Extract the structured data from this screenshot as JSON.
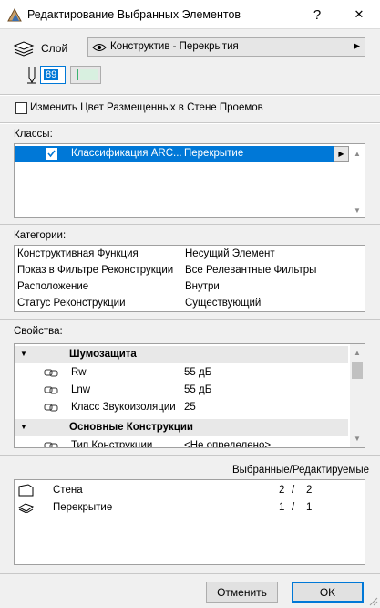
{
  "window": {
    "title": "Редактирование Выбранных Элементов",
    "help_glyph": "?",
    "close_glyph": "✕"
  },
  "layer": {
    "label": "Слой",
    "value": "Конструктив - Перекрытия"
  },
  "pen": {
    "value": "89"
  },
  "change_color_checkbox": {
    "label": "Изменить Цвет Размещенных в Стене Проемов",
    "checked": false
  },
  "classes": {
    "heading": "Классы:",
    "rows": [
      {
        "system": "Классификация ARC...",
        "value": "Перекрытие",
        "checked": true
      }
    ]
  },
  "categories": {
    "heading": "Категории:",
    "rows": [
      {
        "name": "Конструктивная Функция",
        "value": "Несущий Элемент"
      },
      {
        "name": "Показ в Фильтре Реконструкции",
        "value": "Все Релевантные Фильтры"
      },
      {
        "name": "Расположение",
        "value": "Внутри"
      },
      {
        "name": "Статус Реконструкции",
        "value": "Существующий"
      }
    ]
  },
  "properties": {
    "heading": "Свойства:",
    "group1": {
      "name": "Шумозащита"
    },
    "rows1": [
      {
        "name": "Rw",
        "value": "55 дБ"
      },
      {
        "name": "Lnw",
        "value": "55 дБ"
      },
      {
        "name": "Класс Звукоизоляции",
        "value": "25"
      }
    ],
    "group2": {
      "name": "Основные Конструкции"
    },
    "rows2": [
      {
        "name": "Тип Конструкции",
        "value": "<Не определено>"
      }
    ]
  },
  "selection": {
    "header": "Выбранные/Редактируемые",
    "rows": [
      {
        "name": "Стена",
        "selected": "2",
        "sep": "/",
        "editable": "2"
      },
      {
        "name": "Перекрытие",
        "selected": "1",
        "sep": "/",
        "editable": "1"
      }
    ]
  },
  "buttons": {
    "cancel": "Отменить",
    "ok": "OK"
  },
  "colors": {
    "selected_row": "#0078d7",
    "panel_border": "#a0a0a0",
    "dialog_bg": "#f0f0f0"
  }
}
